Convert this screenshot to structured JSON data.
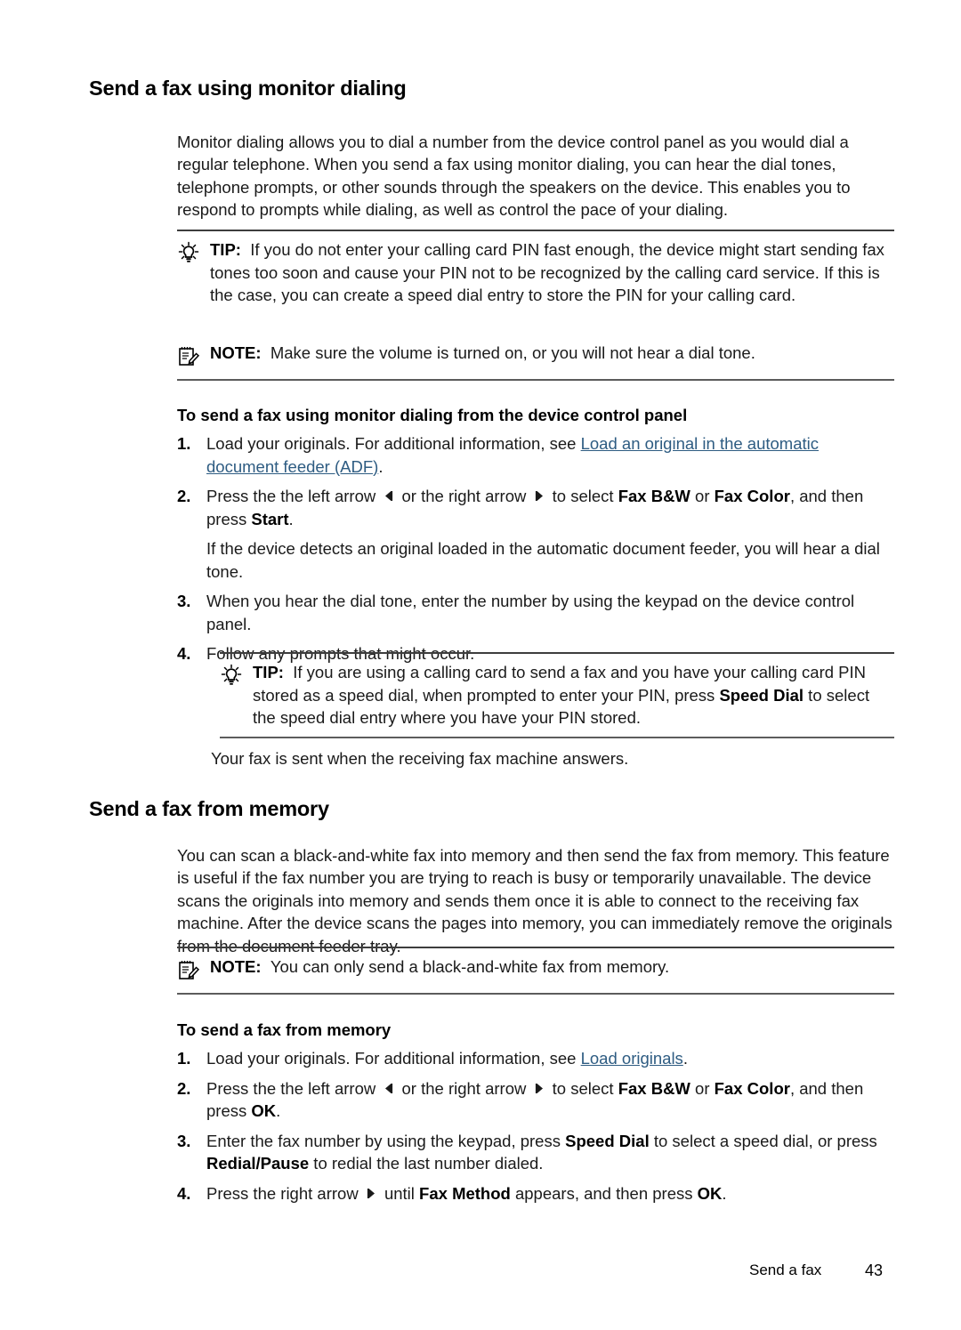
{
  "document": {
    "type": "printer-user-guide-page",
    "link_color": "#2e5c82"
  },
  "sections": [
    {
      "heading": "Send a fax using monitor dialing",
      "intro": "Monitor dialing allows you to dial a number from the device control panel as you would dial a regular telephone. When you send a fax using monitor dialing, you can hear the dial tones, telephone prompts, or other sounds through the speakers on the device. This enables you to respond to prompts while dialing, as well as control the pace of your dialing.",
      "procedure_heading": "To send a fax using monitor dialing from the device control panel"
    },
    {
      "heading": "Send a fax from memory",
      "intro": "You can scan a black-and-white fax into memory and then send the fax from memory. This feature is useful if the fax number you are trying to reach is busy or temporarily unavailable. The device scans the originals into memory and sends them once it is able to connect to the receiving fax machine. After the device scans the pages into memory, you can immediately remove the originals from the document feeder tray.",
      "procedure_heading": "To send a fax from memory"
    }
  ],
  "callouts": {
    "tip_1": {
      "label": "TIP:",
      "icon": "lightbulb-icon",
      "text": "If you do not enter your calling card PIN fast enough, the device might start sending fax tones too soon and cause your PIN not to be recognized by the calling card service. If this is the case, you can create a speed dial entry to store the PIN for your calling card."
    },
    "note_1": {
      "label": "NOTE:",
      "icon": "notepad-pencil-icon",
      "text": "Make sure the volume is turned on, or you will not hear a dial tone."
    },
    "tip_2": {
      "label": "TIP:",
      "icon": "lightbulb-icon",
      "text_part1": "If you are using a calling card to send a fax and you have your calling card PIN stored as a speed dial, when prompted to enter your PIN, press ",
      "bold1": "Speed Dial",
      "text_part2": " to select the speed dial entry where you have your PIN stored."
    },
    "note_2": {
      "label": "NOTE:",
      "icon": "notepad-pencil-icon",
      "text": "You can only send a black-and-white fax from memory."
    }
  },
  "steps_monitor": {
    "step1": {
      "num": "1.",
      "text_before": "Load your originals. For additional information, see ",
      "link": "Load an original in the automatic document feeder (ADF)",
      "text_after": "."
    },
    "step2": {
      "num": "2.",
      "t1": "Press the the left arrow ",
      "t2": " or the right arrow ",
      "t3": " to select ",
      "b1": "Fax B&W",
      "t4": " or ",
      "b2": "Fax Color",
      "t5": ", and then press ",
      "b3": "Start",
      "t6": ".",
      "sub": "If the device detects an original loaded in the automatic document feeder, you will hear a dial tone."
    },
    "step3": {
      "num": "3.",
      "text": "When you hear the dial tone, enter the number by using the keypad on the device control panel."
    },
    "step4": {
      "num": "4.",
      "text": "Follow any prompts that might occur."
    }
  },
  "standalone_sentence": "Your fax is sent when the receiving fax machine answers.",
  "steps_memory": {
    "step1": {
      "num": "1.",
      "text_before": "Load your originals. For additional information, see ",
      "link": "Load originals",
      "text_after": "."
    },
    "step2": {
      "num": "2.",
      "t1": "Press the the left arrow ",
      "t2": " or the right arrow ",
      "t3": " to select ",
      "b1": "Fax B&W",
      "t4": " or ",
      "b2": "Fax Color",
      "t5": ", and then press ",
      "b3": "OK",
      "t6": "."
    },
    "step3": {
      "num": "3.",
      "t1": "Enter the fax number by using the keypad, press ",
      "b1": "Speed Dial",
      "t2": " to select a speed dial, or press ",
      "b2": "Redial/Pause",
      "t3": " to redial the last number dialed."
    },
    "step4": {
      "num": "4.",
      "t1": "Press the right arrow ",
      "t2": " until ",
      "b1": "Fax Method",
      "t3": " appears, and then press ",
      "b2": "OK",
      "t4": "."
    }
  },
  "footer": {
    "label": "Send a fax",
    "page_number": "43"
  }
}
